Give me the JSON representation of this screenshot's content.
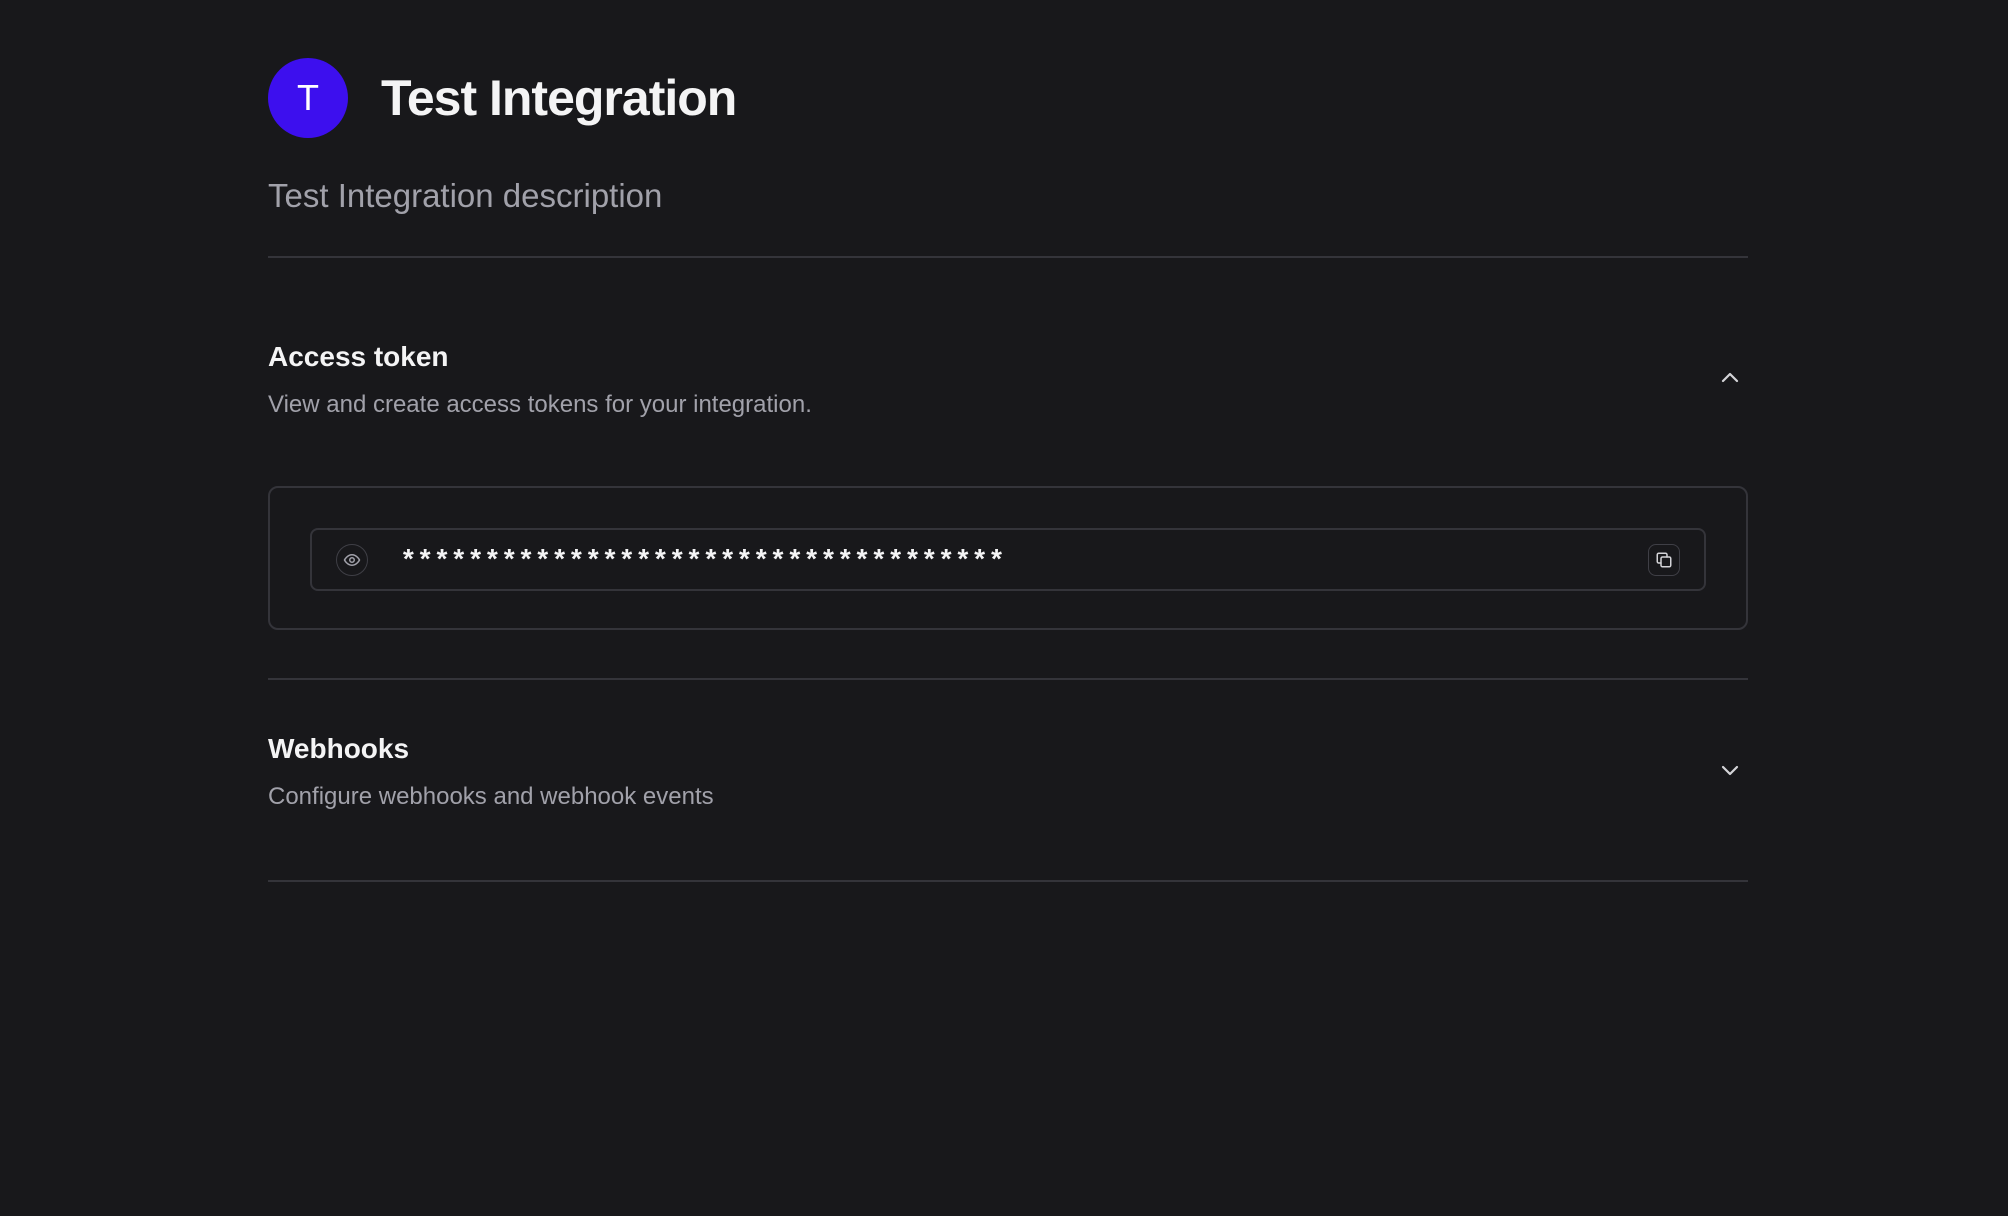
{
  "header": {
    "avatar_letter": "T",
    "avatar_color": "#3d0fee",
    "title": "Test Integration",
    "description": "Test Integration description"
  },
  "sections": {
    "access_token": {
      "title": "Access token",
      "subtitle": "View and create access tokens for your integration.",
      "expanded": true,
      "chevron_icon": "chevron-up-icon",
      "token": {
        "masked_value": "************************************",
        "reveal_icon": "eye-icon",
        "copy_icon": "copy-icon"
      }
    },
    "webhooks": {
      "title": "Webhooks",
      "subtitle": "Configure webhooks and webhook events",
      "expanded": false,
      "chevron_icon": "chevron-down-icon"
    }
  },
  "colors": {
    "background": "#18181b",
    "border": "#34343a",
    "text_primary": "#f4f4f5",
    "text_secondary": "#a1a1aa"
  }
}
